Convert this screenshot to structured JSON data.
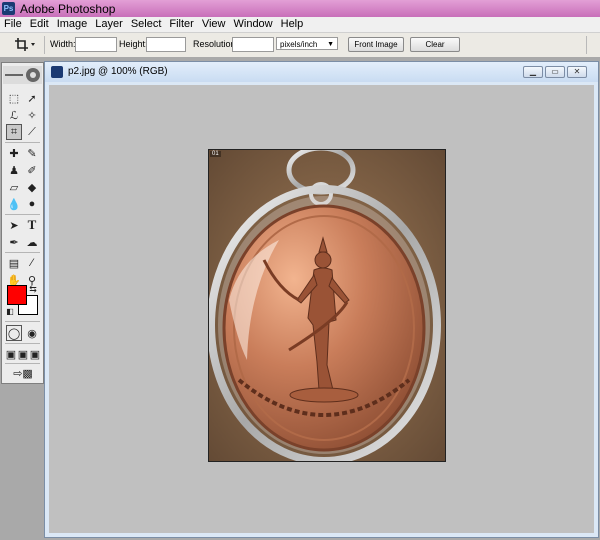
{
  "app": {
    "title": "Adobe Photoshop"
  },
  "menu": [
    "File",
    "Edit",
    "Image",
    "Layer",
    "Select",
    "Filter",
    "View",
    "Window",
    "Help"
  ],
  "options": {
    "width_label": "Width:",
    "height_label": "Height:",
    "resolution_label": "Resolution:",
    "units_value": "pixels/inch",
    "front_image": "Front Image",
    "clear": "Clear"
  },
  "colors": {
    "foreground": "#ff0000",
    "background": "#ffffff"
  },
  "document": {
    "title": "p2.jpg @ 100% (RGB)",
    "photo_tag": "01"
  },
  "toolbox": {
    "tools": [
      "marquee-icon",
      "move-icon",
      "lasso-icon",
      "magic-wand-icon",
      "crop-icon",
      "slice-icon",
      "healing-brush-icon",
      "brush-icon",
      "clone-stamp-icon",
      "history-brush-icon",
      "eraser-icon",
      "paint-bucket-icon",
      "blur-icon",
      "dodge-icon",
      "path-selection-icon",
      "type-icon",
      "pen-icon",
      "custom-shape-icon",
      "notes-icon",
      "eyedropper-icon",
      "hand-icon",
      "zoom-icon"
    ]
  }
}
